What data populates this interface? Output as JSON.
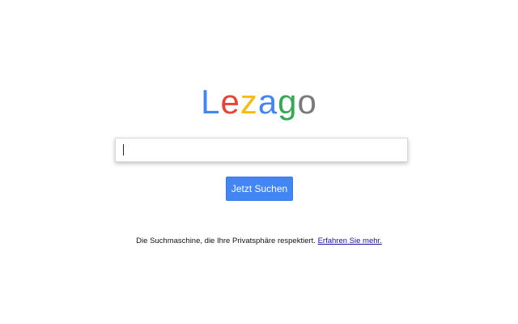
{
  "logo": {
    "letters": [
      {
        "char": "L",
        "color": "#4285f4"
      },
      {
        "char": "e",
        "color": "#ea4335"
      },
      {
        "char": "z",
        "color": "#fbbc05"
      },
      {
        "char": "a",
        "color": "#4285f4"
      },
      {
        "char": "g",
        "color": "#34a853"
      },
      {
        "char": "o",
        "color": "#7a7a7a"
      }
    ]
  },
  "search": {
    "value": "",
    "placeholder": ""
  },
  "button": {
    "label": "Jetzt Suchen",
    "color": "#4285f4"
  },
  "footer": {
    "text": "Die Suchmaschine, die Ihre Privatsphäre respektiert.",
    "link_text": "Erfahren Sie mehr."
  }
}
